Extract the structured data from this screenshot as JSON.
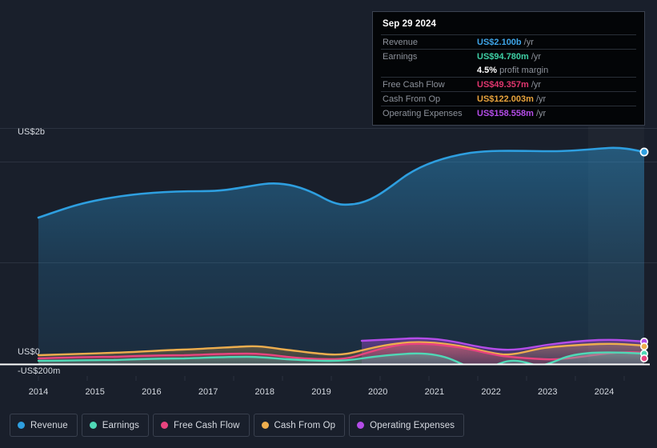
{
  "chart_data": {
    "type": "area",
    "title": "",
    "xlabel": "",
    "ylabel": "",
    "grid": true,
    "legend_position": "bottom",
    "x": [
      2014,
      2015,
      2016,
      2017,
      2018,
      2019,
      2020,
      2021,
      2022,
      2023,
      2024
    ],
    "x_tick_labels": [
      "2014",
      "2015",
      "2016",
      "2017",
      "2018",
      "2019",
      "2020",
      "2021",
      "2022",
      "2023",
      "2024"
    ],
    "y_tick_labels": [
      "US$2b",
      "US$0",
      "-US$200m"
    ],
    "ylim": [
      -200000000,
      2300000000
    ],
    "currency": "US$",
    "series": [
      {
        "name": "Revenue",
        "color": "#2e9fe0",
        "end_value_label": "US$2.100b",
        "values": [
          1180,
          1290,
          1400,
          1420,
          1480,
          1390,
          1310,
          1500,
          1860,
          1940,
          2100
        ]
      },
      {
        "name": "Earnings",
        "color": "#4fd8b6",
        "end_value_label": "US$94.780m",
        "values": [
          22,
          26,
          30,
          36,
          30,
          22,
          36,
          8,
          -52,
          18,
          94.78
        ]
      },
      {
        "name": "Free Cash Flow",
        "color": "#e8447f",
        "end_value_label": "US$49.357m",
        "values": [
          28,
          30,
          34,
          40,
          32,
          28,
          86,
          132,
          118,
          34,
          49.357
        ]
      },
      {
        "name": "Cash From Op",
        "color": "#eeae4e",
        "end_value_label": "US$122.003m",
        "values": [
          48,
          58,
          70,
          86,
          72,
          62,
          128,
          142,
          118,
          96,
          122.003
        ]
      },
      {
        "name": "Operating Expenses",
        "color": "#b44ce8",
        "end_value_label": "US$158.558m",
        "values": [
          null,
          null,
          null,
          null,
          null,
          null,
          150,
          166,
          150,
          152,
          158.558
        ]
      }
    ],
    "highlight_band": {
      "from": "2024",
      "label": ""
    }
  },
  "tooltip": {
    "date": "Sep 29 2024",
    "unit_suffix": "/yr",
    "rows": [
      {
        "label": "Revenue",
        "value": "US$2.100b",
        "unit": "/yr",
        "color": "#3ea5e8"
      },
      {
        "label": "Earnings",
        "value": "US$94.780m",
        "unit": "/yr",
        "color": "#3ecfa4"
      },
      {
        "label": "Free Cash Flow",
        "value": "US$49.357m",
        "unit": "/yr",
        "color": "#e0366e"
      },
      {
        "label": "Cash From Op",
        "value": "US$122.003m",
        "unit": "/yr",
        "color": "#e8a33c"
      },
      {
        "label": "Operating Expenses",
        "value": "US$158.558m",
        "unit": "/yr",
        "color": "#b44ce8"
      }
    ],
    "profit_margin": {
      "value": "4.5%",
      "label": "profit margin"
    }
  },
  "axes": {
    "y_top": "US$2b",
    "y_zero": "US$0",
    "y_negative": "-US$200m",
    "x_ticks": [
      "2014",
      "2015",
      "2016",
      "2017",
      "2018",
      "2019",
      "2020",
      "2021",
      "2022",
      "2023",
      "2024"
    ]
  },
  "legend": {
    "items": [
      {
        "label": "Revenue",
        "color": "#2e9fe0"
      },
      {
        "label": "Earnings",
        "color": "#4fd8b6"
      },
      {
        "label": "Free Cash Flow",
        "color": "#e8447f"
      },
      {
        "label": "Cash From Op",
        "color": "#eeae4e"
      },
      {
        "label": "Operating Expenses",
        "color": "#b44ce8"
      }
    ]
  },
  "colors": {
    "background": "#191f2b",
    "tooltip_background": "#030507",
    "tooltip_border": "#3b4250",
    "gridline": "#2b323f",
    "baseline": "#ffffff",
    "axis_text": "#d6dae1",
    "muted_text": "#8d929b"
  }
}
